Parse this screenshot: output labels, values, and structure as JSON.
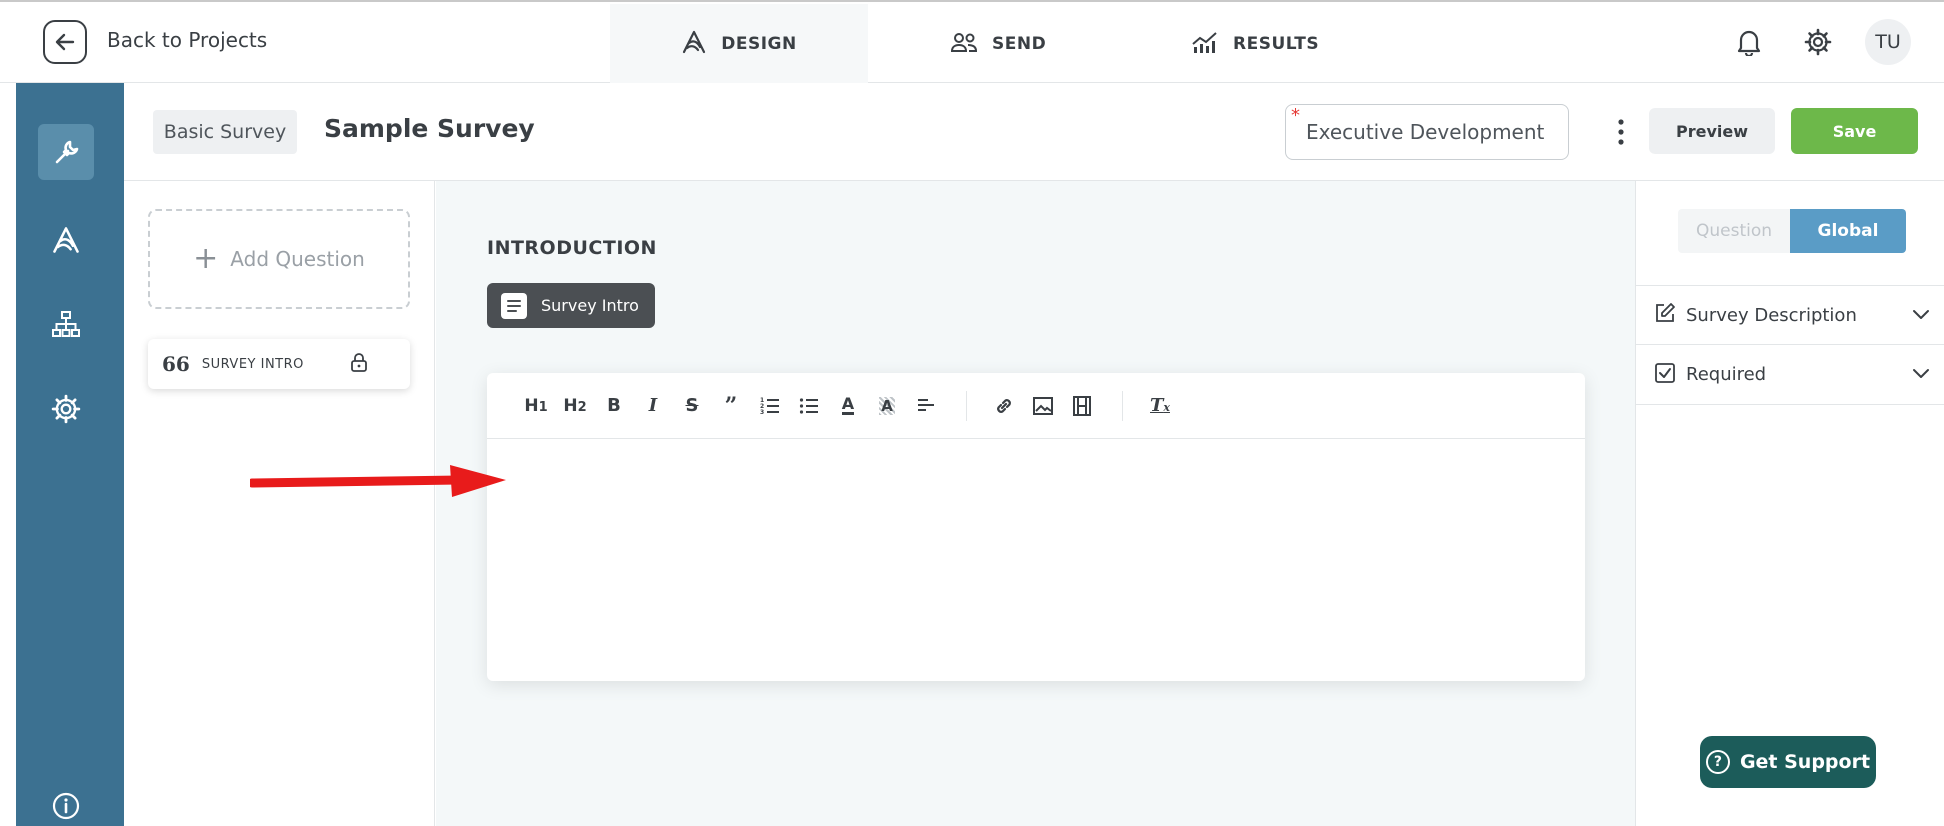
{
  "topbar": {
    "back_label": "Back to Projects",
    "tabs": [
      {
        "label": "DESIGN",
        "icon": "design-logo-icon",
        "active": true
      },
      {
        "label": "SEND",
        "icon": "users-icon",
        "active": false
      },
      {
        "label": "RESULTS",
        "icon": "chart-icon",
        "active": false
      }
    ],
    "avatar_initials": "TU"
  },
  "header": {
    "type_label": "Basic Survey",
    "title": "Sample Survey",
    "name_value": "Executive Development As",
    "preview_label": "Preview",
    "save_label": "Save"
  },
  "questions": {
    "add_label": "Add Question",
    "items": [
      {
        "label": "SURVEY INTRO",
        "icon": "quote-icon",
        "locked": true
      }
    ]
  },
  "canvas": {
    "section_heading": "INTRODUCTION",
    "chip_label": "Survey Intro",
    "toolbar": [
      "H1",
      "H2",
      "B",
      "I",
      "S",
      "”",
      "ol",
      "ul",
      "A",
      "A-bg",
      "align",
      "link",
      "image",
      "video",
      "Tx"
    ]
  },
  "right_panel": {
    "tab_question": "Question",
    "tab_global": "Global",
    "rows": [
      {
        "label": "Survey Description",
        "icon": "edit-icon"
      },
      {
        "label": "Required",
        "icon": "checkbox-icon"
      }
    ]
  },
  "support": {
    "label": "Get Support"
  },
  "colors": {
    "rail": "#3c7191",
    "save": "#6db84a",
    "global_tab": "#5a9cc6",
    "support": "#1c5c5a",
    "arrow": "#e81b1b"
  }
}
